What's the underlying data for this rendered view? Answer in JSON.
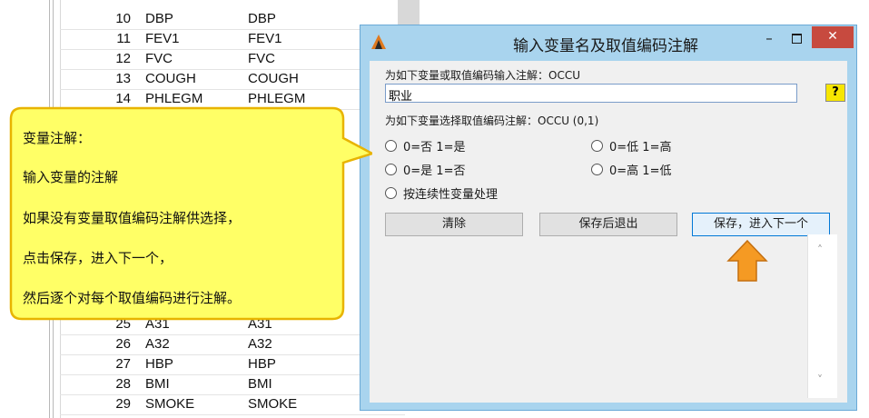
{
  "sheet": {
    "rows": [
      {
        "num": "10",
        "name": "DBP",
        "label": "DBP"
      },
      {
        "num": "11",
        "name": "FEV1",
        "label": "FEV1"
      },
      {
        "num": "12",
        "name": "FVC",
        "label": "FVC"
      },
      {
        "num": "13",
        "name": "COUGH",
        "label": "COUGH"
      },
      {
        "num": "14",
        "name": "PHLEGM",
        "label": "PHLEGM"
      },
      {
        "num": "25",
        "name": "A31",
        "label": "A31"
      },
      {
        "num": "26",
        "name": "A32",
        "label": "A32"
      },
      {
        "num": "27",
        "name": "HBP",
        "label": "HBP"
      },
      {
        "num": "28",
        "name": "BMI",
        "label": "BMI"
      },
      {
        "num": "29",
        "name": "SMOKE",
        "label": "SMOKE"
      }
    ]
  },
  "dialog": {
    "title": "输入变量名及取值编码注解",
    "minimize_glyph": "–",
    "close_glyph": "✕",
    "var_prompt": "为如下变量或取值编码输入注解：OCCU",
    "var_value": "职业",
    "help_label": "?",
    "code_prompt": "为如下变量选择取值编码注解：OCCU (0,1)",
    "options": [
      "0=否 1=是",
      "0=低 1=高",
      "0=是 1=否",
      "0=高 1=低",
      "按连续性变量处理"
    ],
    "buttons": {
      "clear": "清除",
      "save_exit": "保存后退出",
      "save_next": "保存，进入下一个"
    },
    "scroll_up": "˄",
    "scroll_down": "˅"
  },
  "callout": {
    "lines": [
      "变量注解：",
      "输入变量的注解",
      "如果没有变量取值编码注解供选择，",
      "点击保存，进入下一个，",
      "然后逐个对每个取值编码进行注解。"
    ]
  },
  "colors": {
    "callout_fill": "#ffff66",
    "callout_border": "#e8b400",
    "arrow_fill": "#f59a23",
    "close_button": "#c74a3f",
    "dialog_frame": "#a9d4ee"
  }
}
